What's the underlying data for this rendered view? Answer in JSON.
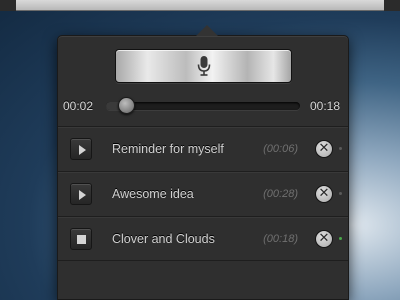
{
  "player": {
    "current_time": "00:02",
    "total_time": "00:18",
    "progress": 0.07,
    "record_icon": "microphone-icon"
  },
  "recordings": [
    {
      "title": "Reminder for myself",
      "duration": "(00:06)",
      "control": "play-icon",
      "status": "inactive"
    },
    {
      "title": "Awesome idea",
      "duration": "(00:28)",
      "control": "play-icon",
      "status": "inactive"
    },
    {
      "title": "Clover and Clouds",
      "duration": "(00:18)",
      "control": "stop-icon",
      "status": "active"
    }
  ],
  "colors": {
    "popover_bg": "#2f2f2f",
    "active_dot": "#4aa84a"
  }
}
